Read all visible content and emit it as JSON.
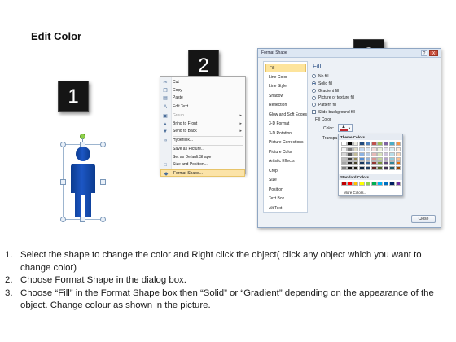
{
  "title": "Edit Color",
  "steps": [
    "1",
    "2",
    "3"
  ],
  "figure_color": "#0b3b8e",
  "context_menu": {
    "items": [
      {
        "label": "Cut",
        "icon": "scissors-icon",
        "disabled": false,
        "submenu": false
      },
      {
        "label": "Copy",
        "icon": "copy-icon",
        "disabled": false,
        "submenu": false
      },
      {
        "label": "Paste",
        "icon": "paste-icon",
        "disabled": false,
        "submenu": false
      },
      {
        "label": "Edit Text",
        "icon": "text-icon",
        "disabled": false,
        "submenu": false
      },
      {
        "label": "Group",
        "icon": "group-icon",
        "disabled": true,
        "submenu": true
      },
      {
        "label": "Bring to Front",
        "icon": "bring-front-icon",
        "disabled": false,
        "submenu": true
      },
      {
        "label": "Send to Back",
        "icon": "send-back-icon",
        "disabled": false,
        "submenu": true
      },
      {
        "label": "Hyperlink...",
        "icon": "hyperlink-icon",
        "disabled": false,
        "submenu": false
      },
      {
        "label": "Save as Picture...",
        "icon": "",
        "disabled": false,
        "submenu": false
      },
      {
        "label": "Set as Default Shape",
        "icon": "",
        "disabled": false,
        "submenu": false
      },
      {
        "label": "Size and Position...",
        "icon": "size-icon",
        "disabled": false,
        "submenu": false
      },
      {
        "label": "Format Shape...",
        "icon": "format-shape-icon",
        "disabled": false,
        "submenu": false,
        "highlighted": true
      }
    ]
  },
  "dialog": {
    "title": "Format Shape",
    "help": "?",
    "close_x": "X",
    "categories": [
      "Fill",
      "Line Color",
      "Line Style",
      "Shadow",
      "Reflection",
      "Glow and Soft Edges",
      "3-D Format",
      "3-D Rotation",
      "Picture Corrections",
      "Picture Color",
      "Artistic Effects",
      "Crop",
      "Size",
      "Position",
      "Text Box",
      "Alt Text"
    ],
    "selected_category": "Fill",
    "pane_heading": "Fill",
    "options": [
      {
        "label": "No fill",
        "type": "radio",
        "checked": false
      },
      {
        "label": "Solid fill",
        "type": "radio",
        "checked": true
      },
      {
        "label": "Gradient fill",
        "type": "radio",
        "checked": false
      },
      {
        "label": "Picture or texture fill",
        "type": "radio",
        "checked": false
      },
      {
        "label": "Pattern fill",
        "type": "radio",
        "checked": false
      },
      {
        "label": "Slide background fill",
        "type": "checkbox",
        "checked": false
      }
    ],
    "fill_color_label": "Fill Color",
    "color_label": "Color:",
    "transparency_label": "Transpa",
    "palette": {
      "theme_heading": "Theme Colors",
      "standard_heading": "Standard Colors",
      "more_colors": "More Colors...",
      "theme_top": [
        "#ffffff",
        "#000000",
        "#eeece1",
        "#1f497d",
        "#4f81bd",
        "#c0504d",
        "#9bbb59",
        "#8064a2",
        "#4bacc6",
        "#f79646"
      ],
      "theme_shades": [
        [
          "#f2f2f2",
          "#7f7f7f",
          "#ddd9c3",
          "#c6d9f0",
          "#dbe5f1",
          "#f2dcdb",
          "#ebf1dd",
          "#e5e0ec",
          "#dbeef3",
          "#fdeada"
        ],
        [
          "#d8d8d8",
          "#595959",
          "#c4bd97",
          "#8db3e2",
          "#b8cce4",
          "#e5b9b7",
          "#d7e3bc",
          "#ccc1d9",
          "#b7dde8",
          "#fbd5b5"
        ],
        [
          "#bfbfbf",
          "#3f3f3f",
          "#938953",
          "#548dd4",
          "#95b3d7",
          "#d99694",
          "#c3d69b",
          "#b2a2c7",
          "#92cddc",
          "#fac08f"
        ],
        [
          "#a5a5a5",
          "#262626",
          "#494429",
          "#17365d",
          "#366092",
          "#953734",
          "#76923c",
          "#5f497a",
          "#31859b",
          "#e36c09"
        ],
        [
          "#7f7f7f",
          "#0c0c0c",
          "#1d1b10",
          "#0f243e",
          "#244061",
          "#632423",
          "#4f6128",
          "#3f3151",
          "#205867",
          "#974806"
        ]
      ],
      "standard": [
        "#c00000",
        "#ff0000",
        "#ffc000",
        "#ffff00",
        "#92d050",
        "#00b050",
        "#00b0f0",
        "#0070c0",
        "#002060",
        "#7030a0"
      ]
    },
    "close_button": "Close"
  },
  "instructions": [
    {
      "num": "1.",
      "text": "Select the shape to change the color and Right click the object( click any object which you want to change color)"
    },
    {
      "num": "2.",
      "text": "Choose Format Shape in the dialog box."
    },
    {
      "num": "3.",
      "text": "Choose “Fill” in the Format Shape box then “Solid” or “Gradient” depending on the appearance of the object. Change colour as shown in the picture."
    }
  ]
}
